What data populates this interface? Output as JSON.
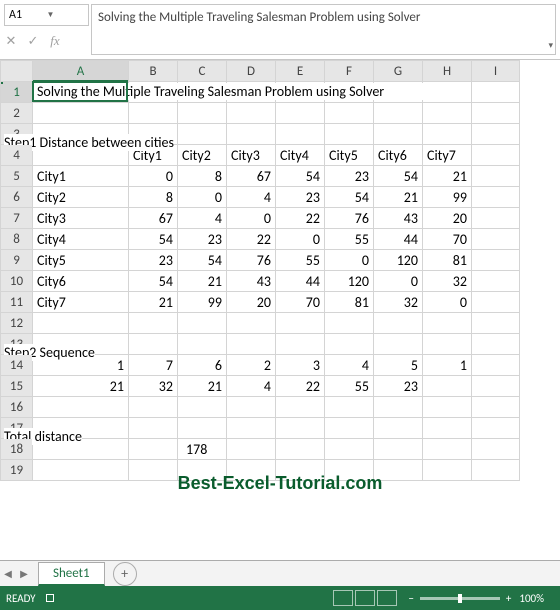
{
  "formula": {
    "cellref": "A1",
    "text": "Solving the Multiple Traveling Salesman Problem using Solver"
  },
  "cols": [
    "A",
    "B",
    "C",
    "D",
    "E",
    "F",
    "G",
    "H",
    "I"
  ],
  "rows": [
    "1",
    "2",
    "3",
    "4",
    "5",
    "6",
    "7",
    "8",
    "9",
    "10",
    "11",
    "12",
    "13",
    "14",
    "15",
    "16",
    "17",
    "18",
    "19"
  ],
  "title": "Solving the Multiple Traveling Salesman Problem using Solver",
  "step1": "Step1 Distance between cities",
  "cities": [
    "City1",
    "City2",
    "City3",
    "City4",
    "City5",
    "City6",
    "City7"
  ],
  "dist": [
    [
      0,
      8,
      67,
      54,
      23,
      54,
      21
    ],
    [
      8,
      0,
      4,
      23,
      54,
      21,
      99
    ],
    [
      67,
      4,
      0,
      22,
      76,
      43,
      20
    ],
    [
      54,
      23,
      22,
      0,
      55,
      44,
      70
    ],
    [
      23,
      54,
      76,
      55,
      0,
      120,
      81
    ],
    [
      54,
      21,
      43,
      44,
      120,
      0,
      32
    ],
    [
      21,
      99,
      20,
      70,
      81,
      32,
      0
    ]
  ],
  "step2": "Step2 Sequence",
  "seq": [
    1,
    7,
    6,
    2,
    3,
    4,
    5,
    1
  ],
  "seqd": [
    21,
    32,
    21,
    4,
    22,
    55,
    23
  ],
  "td_label": "Total distance",
  "td_val": 178,
  "tab": "Sheet1",
  "status": {
    "ready": "READY",
    "zoom": "100%"
  },
  "watermark": "Best-Excel-Tutorial.com",
  "chart_data": {
    "type": "table",
    "tables": [
      {
        "name": "Distance between cities",
        "row_labels": [
          "City1",
          "City2",
          "City3",
          "City4",
          "City5",
          "City6",
          "City7"
        ],
        "col_labels": [
          "City1",
          "City2",
          "City3",
          "City4",
          "City5",
          "City6",
          "City7"
        ],
        "values": [
          [
            0,
            8,
            67,
            54,
            23,
            54,
            21
          ],
          [
            8,
            0,
            4,
            23,
            54,
            21,
            99
          ],
          [
            67,
            4,
            0,
            22,
            76,
            43,
            20
          ],
          [
            54,
            23,
            22,
            0,
            55,
            44,
            70
          ],
          [
            23,
            54,
            76,
            55,
            0,
            120,
            81
          ],
          [
            54,
            21,
            43,
            44,
            120,
            0,
            32
          ],
          [
            21,
            99,
            20,
            70,
            81,
            32,
            0
          ]
        ]
      },
      {
        "name": "Sequence",
        "values": [
          [
            1,
            7,
            6,
            2,
            3,
            4,
            5,
            1
          ],
          [
            21,
            32,
            21,
            4,
            22,
            55,
            23,
            null
          ]
        ]
      },
      {
        "name": "Total distance",
        "values": [
          [
            178
          ]
        ]
      }
    ]
  }
}
